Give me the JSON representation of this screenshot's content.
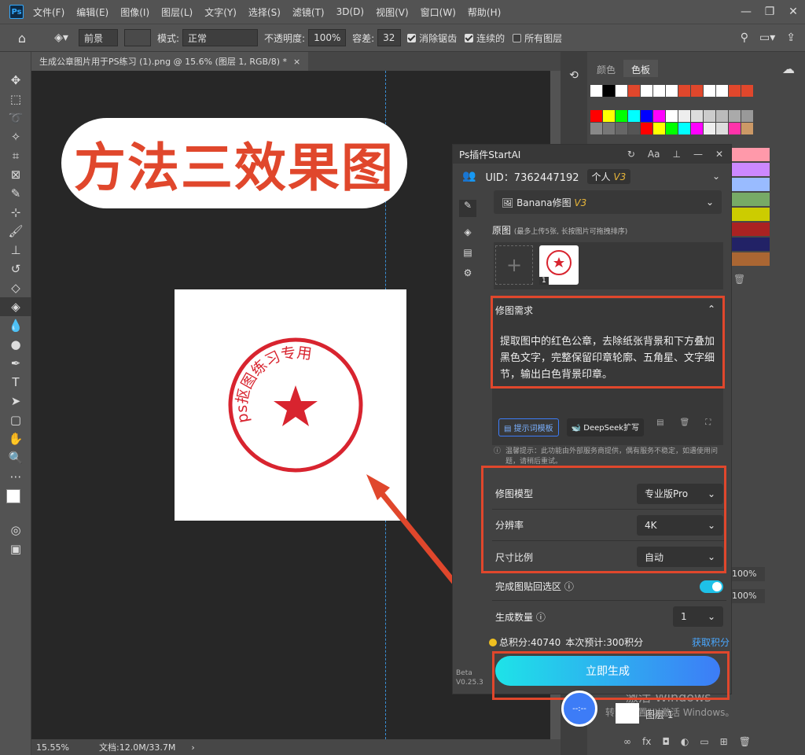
{
  "app": {
    "logo": "Ps"
  },
  "menu": [
    "文件(F)",
    "编辑(E)",
    "图像(I)",
    "图层(L)",
    "文字(Y)",
    "选择(S)",
    "滤镜(T)",
    "3D(D)",
    "视图(V)",
    "窗口(W)",
    "帮助(H)"
  ],
  "options": {
    "tool_preset": "前景",
    "mode_label": "模式:",
    "mode_value": "正常",
    "opacity_label": "不透明度:",
    "opacity_value": "100%",
    "tolerance_label": "容差:",
    "tolerance_value": "32",
    "antialias": "消除锯齿",
    "contiguous": "连续的",
    "all_layers": "所有图层"
  },
  "doc_tab": {
    "title": "生成公章图片用于PS练习 (1).png @ 15.6% (图层 1, RGB/8) *",
    "close": "×"
  },
  "canvas": {
    "headline": "方法三效果图",
    "stamp_text": "ps抠图练习专用"
  },
  "status": {
    "zoom": "15.55%",
    "doc": "文档:12.0M/33.7M"
  },
  "right_panel": {
    "tab_color": "颜色",
    "tab_swatches": "色板",
    "opacity1": "100%",
    "opacity2": "100%",
    "layer_name": "图层 1"
  },
  "plugin": {
    "title": "Ps插件StartAI",
    "uid": "UID：7362447192",
    "account": "个人",
    "badge": "V3",
    "mode_name": "Banana修图",
    "mode_badge": "V3",
    "original_label": "原图",
    "original_hint": "(最多上传5张, 长按图片可拖拽排序)",
    "thumb_index": "1",
    "requirement_title": "修图需求",
    "requirement_text": "提取图中的红色公章，去除纸张背景和下方叠加黑色文字，完整保留印章轮廓、五角星、文字细节，输出白色背景印章。",
    "template_btn": "提示词模板",
    "deepseek_btn": "DeepSeek扩写",
    "notice": "温馨提示：此功能由外部服务商提供，偶有服务不稳定，如遇使用问题，请稍后重试。",
    "model_label": "修图模型",
    "model_value": "专业版Pro",
    "res_label": "分辨率",
    "res_value": "4K",
    "ratio_label": "尺寸比例",
    "ratio_value": "自动",
    "paste_label": "完成图贴回选区",
    "count_label": "生成数量",
    "count_value": "1",
    "points": "总积分:40740",
    "estimate": "本次预计:300积分",
    "get_points": "获取积分",
    "generate_btn": "立即生成",
    "beta": "Beta",
    "version": "V0.25.3"
  },
  "watermark": {
    "line1": "激活 Windows",
    "line2": "转到\"设置\"以激活 Windows。"
  },
  "colors": {
    "accent": "#31a8ff",
    "red": "#e0472c",
    "gen_gradient_start": "#1ee3e8",
    "gen_gradient_end": "#3d7cf7"
  }
}
